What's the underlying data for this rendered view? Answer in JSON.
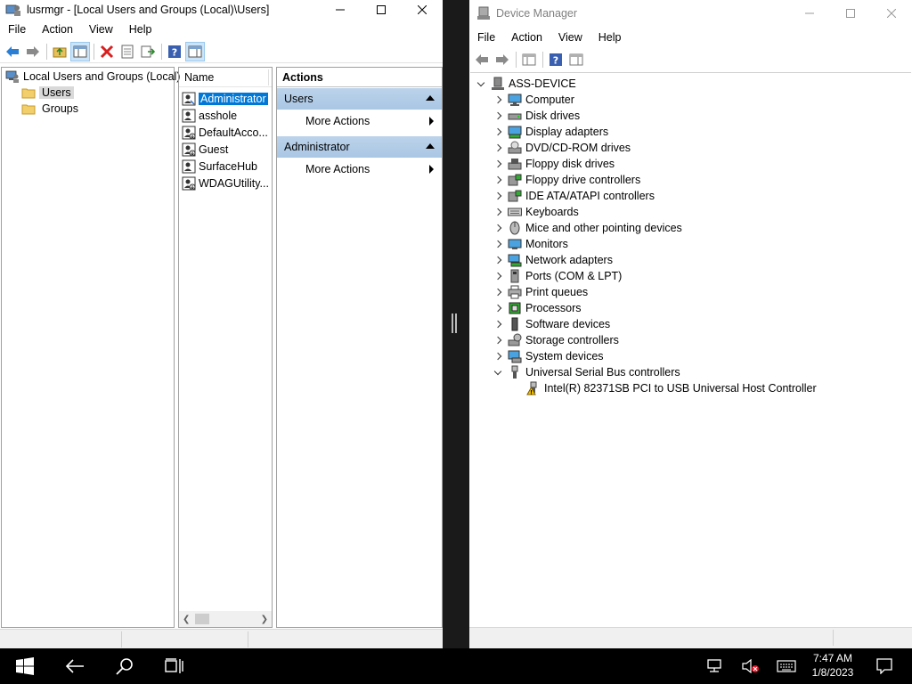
{
  "lusrmgr": {
    "title": "lusrmgr - [Local Users and Groups (Local)\\Users]",
    "menu": [
      "File",
      "Action",
      "View",
      "Help"
    ],
    "tree": {
      "root": "Local Users and Groups (Local)",
      "children": [
        "Users",
        "Groups"
      ],
      "selected": "Users"
    },
    "list": {
      "column": "Name",
      "users": [
        "Administrator",
        "asshole",
        "DefaultAcco...",
        "Guest",
        "SurfaceHub",
        "WDAGUtility..."
      ],
      "selected": "Administrator"
    },
    "actions": {
      "header": "Actions",
      "sections": [
        {
          "title": "Users",
          "item": "More Actions"
        },
        {
          "title": "Administrator",
          "item": "More Actions"
        }
      ]
    }
  },
  "devmgr": {
    "title": "Device Manager",
    "menu": [
      "File",
      "Action",
      "View",
      "Help"
    ],
    "root": "ASS-DEVICE",
    "categories": [
      "Computer",
      "Disk drives",
      "Display adapters",
      "DVD/CD-ROM drives",
      "Floppy disk drives",
      "Floppy drive controllers",
      "IDE ATA/ATAPI controllers",
      "Keyboards",
      "Mice and other pointing devices",
      "Monitors",
      "Network adapters",
      "Ports (COM & LPT)",
      "Print queues",
      "Processors",
      "Software devices",
      "Storage controllers",
      "System devices",
      "Universal Serial Bus controllers"
    ],
    "expanded": "Universal Serial Bus controllers",
    "usb_child": "Intel(R) 82371SB PCI to USB Universal Host Controller"
  },
  "taskbar": {
    "time": "7:47 AM",
    "date": "1/8/2023"
  },
  "colors": {
    "selection": "#0078d7",
    "action_section": "#bcd3ea",
    "taskbar": "#000000"
  }
}
